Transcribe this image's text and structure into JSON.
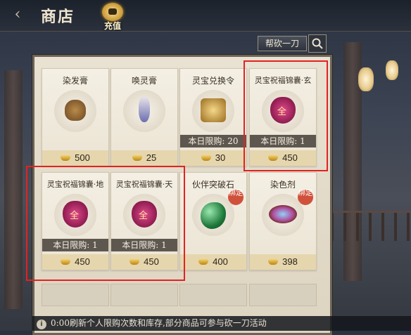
{
  "header": {
    "title": "商店",
    "recharge_label": "充值"
  },
  "search": {
    "cut_label": "帮砍一刀"
  },
  "items": [
    {
      "name": "染发膏",
      "limit": "",
      "price": "500",
      "icon": "hair-dye-jar-icon"
    },
    {
      "name": "唤灵膏",
      "limit": "",
      "price": "25",
      "icon": "spirit-vase-icon"
    },
    {
      "name": "灵宝兑换令",
      "limit": "本日限购: 20",
      "price": "30",
      "icon": "exchange-token-icon"
    },
    {
      "name": "灵宝祝福锦囊·玄",
      "limit": "本日限购: 1",
      "price": "450",
      "icon": "blessing-pouch-icon"
    },
    {
      "name": "灵宝祝福锦囊·地",
      "limit": "本日限购: 1",
      "price": "450",
      "icon": "blessing-pouch-icon"
    },
    {
      "name": "灵宝祝福锦囊·天",
      "limit": "本日限购: 1",
      "price": "450",
      "icon": "blessing-pouch-icon"
    },
    {
      "name": "伙伴突破石",
      "limit": "",
      "price": "400",
      "icon": "breakthrough-stone-icon",
      "badge": "绑定"
    },
    {
      "name": "染色剂",
      "limit": "",
      "price": "398",
      "icon": "dye-agent-icon",
      "badge": "绑定"
    }
  ],
  "footer": {
    "notice": "0:00刷新个人限购次数和库存,部分商品可参与砍一刀活动"
  },
  "colors": {
    "highlight": "#e22222",
    "price_bar": "#e6d6ae",
    "limit_bar": "#5e5750",
    "bound_badge": "#d0513b"
  }
}
